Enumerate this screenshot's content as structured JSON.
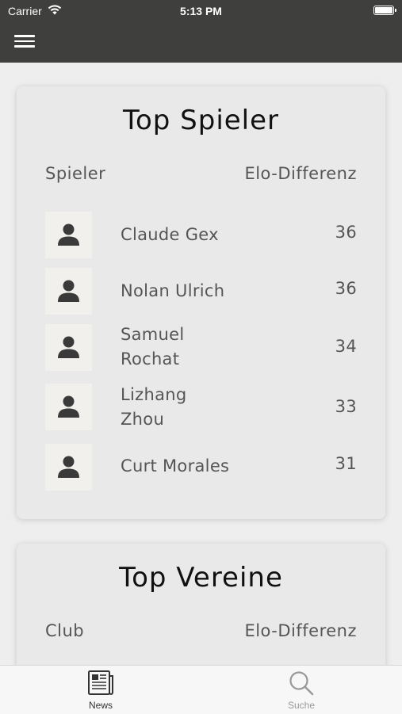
{
  "status_bar": {
    "carrier": "Carrier",
    "time": "5:13 PM"
  },
  "header": {
    "menu_icon": "hamburger-menu-icon"
  },
  "top_players": {
    "title": "Top Spieler",
    "col_left": "Spieler",
    "col_right": "Elo-Differenz",
    "rows": [
      {
        "name": "Claude Gex",
        "value": "36"
      },
      {
        "name": "Nolan Ulrich",
        "value": "36"
      },
      {
        "name": "Samuel Rochat",
        "value": "34"
      },
      {
        "name": "Lizhang Zhou",
        "value": "33"
      },
      {
        "name": "Curt Morales",
        "value": "31"
      }
    ]
  },
  "top_clubs": {
    "title": "Top Vereine",
    "col_left": "Club",
    "col_right": "Elo-Differenz"
  },
  "tabbar": {
    "tabs": [
      {
        "label": "News",
        "icon": "newspaper-icon",
        "active": true
      },
      {
        "label": "Suche",
        "icon": "search-icon",
        "active": false
      }
    ]
  },
  "colors": {
    "header_bg": "#3f3f3e",
    "page_bg": "#eeeeee",
    "card_bg": "#e9e9e9",
    "avatar_bg": "#f1f0ec"
  }
}
